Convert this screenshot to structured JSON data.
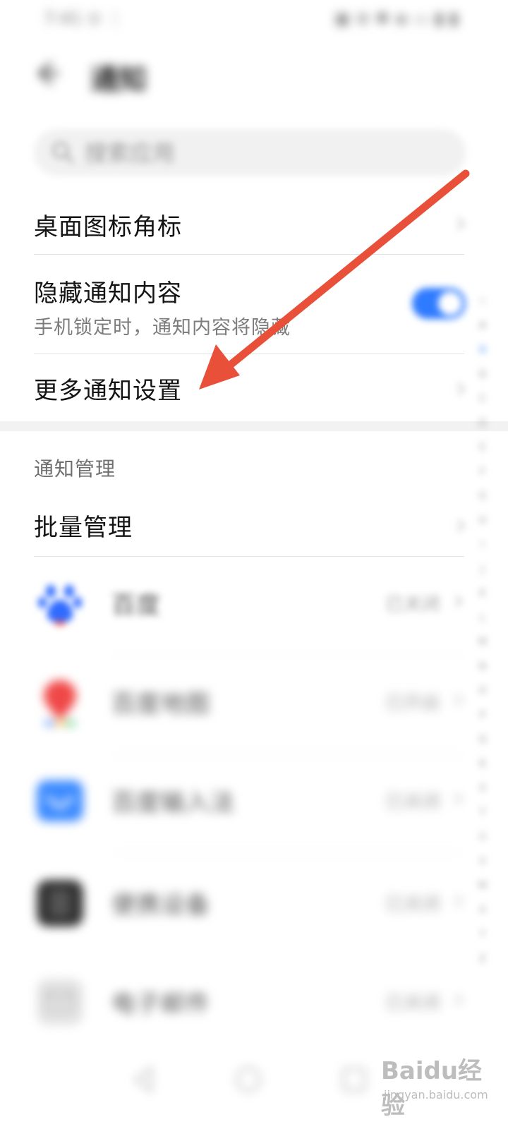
{
  "status_bar": {
    "left_text": "7:41 ⊙ ⋮",
    "right_text": "▣ ⊗ ✱ ◈ ▭ ▮ ▮"
  },
  "header": {
    "title": "通知"
  },
  "search": {
    "placeholder": "搜索应用"
  },
  "settings": {
    "badge": {
      "title": "桌面图标角标"
    },
    "hide_content": {
      "title": "隐藏通知内容",
      "subtitle": "手机锁定时，通知内容将隐藏",
      "enabled": true
    },
    "more": {
      "title": "更多通知设置"
    }
  },
  "section": {
    "label": "通知管理"
  },
  "batch": {
    "title": "批量管理"
  },
  "apps": [
    {
      "name": "百度",
      "status": "已关闭",
      "icon": "baidu-paw-icon",
      "color": "#2f6bff"
    },
    {
      "name": "百度地图",
      "status": "已开启",
      "icon": "map-pin-icon",
      "color": "#f04848"
    },
    {
      "name": "百度输入法",
      "status": "已关闭",
      "icon": "keyboard-icon",
      "color": "#3d8bff"
    },
    {
      "name": "便携设备",
      "status": "已关闭",
      "icon": "device-icon",
      "color": "#333333"
    },
    {
      "name": "电子邮件",
      "status": "已关闭",
      "icon": "mail-icon",
      "color": "#d6d6d6"
    }
  ],
  "alpha_index": [
    "☆",
    "#",
    "A",
    "B",
    "C",
    "D",
    "E",
    "F",
    "G",
    "H",
    "I",
    "J",
    "K",
    "L",
    "M",
    "N",
    "O",
    "P",
    "Q",
    "R",
    "S",
    "T",
    "U",
    "V",
    "W",
    "X",
    "Y",
    "Z"
  ],
  "watermark": {
    "logo": "Baidu经验",
    "url": "jingyan.baidu.com"
  },
  "colors": {
    "accent": "#2f7bff",
    "arrow": "#e8503a"
  }
}
